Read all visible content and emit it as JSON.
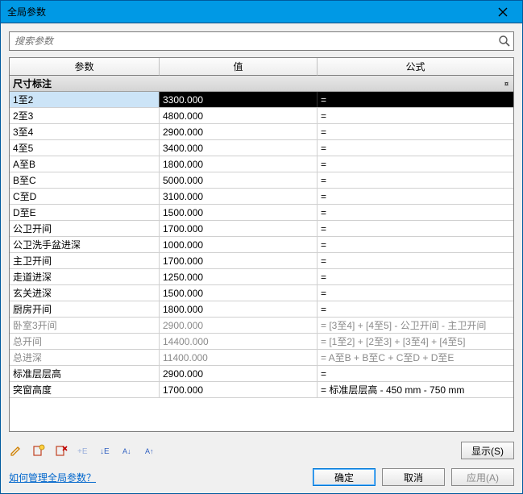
{
  "window": {
    "title": "全局参数"
  },
  "search": {
    "placeholder": "搜索参数"
  },
  "columns": {
    "param": "参数",
    "value": "值",
    "formula": "公式"
  },
  "group": {
    "label": "尺寸标注"
  },
  "rows": [
    {
      "param": "1至2",
      "value": "3300.000",
      "formula": "=",
      "selected": true,
      "readonly": false
    },
    {
      "param": "2至3",
      "value": "4800.000",
      "formula": "=",
      "readonly": false
    },
    {
      "param": "3至4",
      "value": "2900.000",
      "formula": "=",
      "readonly": false
    },
    {
      "param": "4至5",
      "value": "3400.000",
      "formula": "=",
      "readonly": false
    },
    {
      "param": "A至B",
      "value": "1800.000",
      "formula": "=",
      "readonly": false
    },
    {
      "param": "B至C",
      "value": "5000.000",
      "formula": "=",
      "readonly": false
    },
    {
      "param": "C至D",
      "value": "3100.000",
      "formula": "=",
      "readonly": false
    },
    {
      "param": "D至E",
      "value": "1500.000",
      "formula": "=",
      "readonly": false
    },
    {
      "param": "公卫开间",
      "value": "1700.000",
      "formula": "=",
      "readonly": false
    },
    {
      "param": "公卫洗手盆进深",
      "value": "1000.000",
      "formula": "=",
      "readonly": false
    },
    {
      "param": "主卫开间",
      "value": "1700.000",
      "formula": "=",
      "readonly": false
    },
    {
      "param": "走道进深",
      "value": "1250.000",
      "formula": "=",
      "readonly": false
    },
    {
      "param": "玄关进深",
      "value": "1500.000",
      "formula": "=",
      "readonly": false
    },
    {
      "param": "厨房开间",
      "value": "1800.000",
      "formula": "=",
      "readonly": false
    },
    {
      "param": "卧室3开间",
      "value": "2900.000",
      "formula": "= [3至4] + [4至5] - 公卫开间 - 主卫开间",
      "readonly": true
    },
    {
      "param": "总开间",
      "value": "14400.000",
      "formula": "= [1至2] + [2至3] + [3至4] + [4至5]",
      "readonly": true
    },
    {
      "param": "总进深",
      "value": "11400.000",
      "formula": "= A至B + B至C + C至D + D至E",
      "readonly": true
    },
    {
      "param": "标准层层高",
      "value": "2900.000",
      "formula": "=",
      "readonly": false
    },
    {
      "param": "突窗高度",
      "value": "1700.000",
      "formula": "= 标准层层高 - 450 mm - 750 mm",
      "readonly": false
    }
  ],
  "toolbar": {
    "show_label": "显示(S)"
  },
  "footer": {
    "help_link": "如何管理全局参数？",
    "ok": "确定",
    "cancel": "取消",
    "apply": "应用(A)"
  }
}
